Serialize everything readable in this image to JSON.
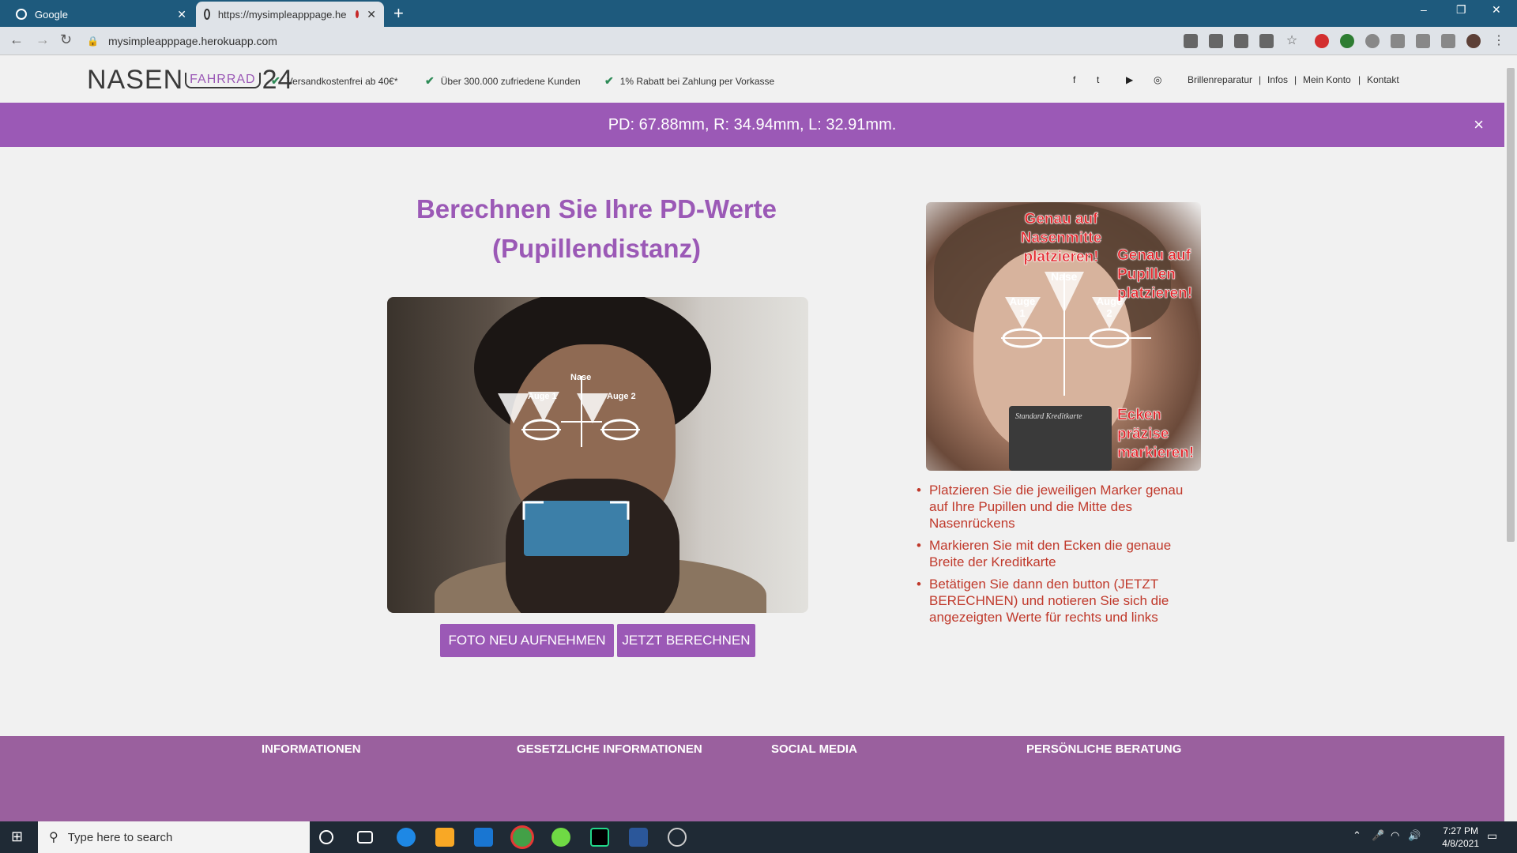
{
  "browser": {
    "tabs": [
      {
        "title": "Google"
      },
      {
        "title": "https://mysimpleapppage.he"
      }
    ],
    "new_tab": "+",
    "url": "mysimpleapppage.herokuapp.com",
    "window_controls": {
      "minimize": "–",
      "restore": "❐",
      "close": "✕"
    }
  },
  "header": {
    "logo": {
      "left": "NASEN",
      "middle": "FAHRRAD",
      "right": "24"
    },
    "usps": [
      "Versandkostenfrei ab 40€*",
      "Über 300.000 zufriedene Kunden",
      "1% Rabatt bei Zahlung per Vorkasse"
    ],
    "social": {
      "facebook": "f",
      "twitter": "t",
      "youtube": "▶",
      "instagram": "◎"
    },
    "links": [
      "Brillenreparatur",
      "|",
      "Infos",
      "|",
      "Mein Konto",
      "|",
      "Kontakt"
    ]
  },
  "banner": {
    "text": "PD: 67.88mm, R: 34.94mm, L: 32.91mm.",
    "close": "×"
  },
  "main": {
    "title_line1": "Berechnen Sie Ihre PD-Werte",
    "title_line2": "(Pupillendistanz)",
    "photo_markers": {
      "nose": "Nase",
      "eye1": "Auge 1",
      "eye2": "Auge 2"
    },
    "buttons": {
      "retake": "FOTO NEU AUFNEHMEN",
      "calculate": "JETZT BERECHNEN"
    }
  },
  "instruction_image": {
    "label_nose": "Genau auf Nasenmitte platzieren!",
    "label_pupils": "Genau auf Pupillen platzieren!",
    "label_corners": "Ecken präzise markieren!",
    "marker_nose": "Nase",
    "marker_eye1": "Auge 1",
    "marker_eye2": "Auge 2",
    "card_text": "Standard Kreditkarte"
  },
  "instructions": [
    "Platzieren Sie die jeweiligen Marker genau auf Ihre Pupillen und die Mitte des Nasenrückens",
    "Markieren Sie mit den Ecken die genaue Breite der Kreditkarte",
    "Betätigen Sie dann den button (JETZT BERECHNEN) und notieren Sie sich die angezeigten Werte für rechts und links"
  ],
  "footer": {
    "columns": [
      "INFORMATIONEN",
      "GESETZLICHE INFORMATIONEN",
      "SOCIAL MEDIA",
      "PERSÖNLICHE BERATUNG"
    ]
  },
  "taskbar": {
    "search_placeholder": "Type here to search",
    "time": "7:27 PM",
    "date": "4/8/2021"
  },
  "colors": {
    "accent": "#9b59b6",
    "instruction_red": "#c0392b",
    "footer": "#9a609e"
  }
}
